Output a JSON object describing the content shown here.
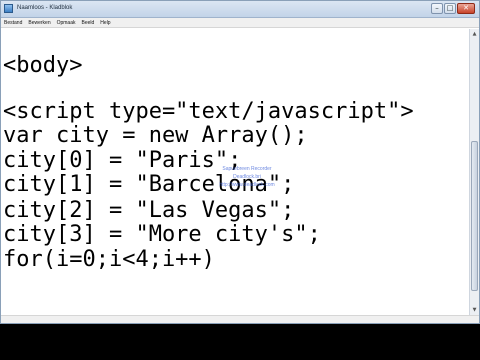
{
  "window": {
    "title": "Naamloos - Kladblok"
  },
  "window_controls": {
    "minimize": "–",
    "maximize": "□",
    "close": "✕"
  },
  "menu": [
    "Bestand",
    "Bewerken",
    "Opmaak",
    "Beeld",
    "Help"
  ],
  "code_lines": [
    "<body>",
    "",
    "<script type=\"text/javascript\">",
    "var city = new Array();",
    "city[0] = \"Paris\";",
    "city[1] = \"Barcelona\";",
    "city[2] = \"Las Vegas\";",
    "city[3] = \"More city's\";",
    "for(i=0;i<4;i++)"
  ],
  "watermark": {
    "title": "Sapuebreen Recorder",
    "line2": "Deadlock.bri",
    "url": "http://www.deadlock.com"
  },
  "scrollbar_arrows": {
    "up": "▲",
    "down": "▼"
  }
}
